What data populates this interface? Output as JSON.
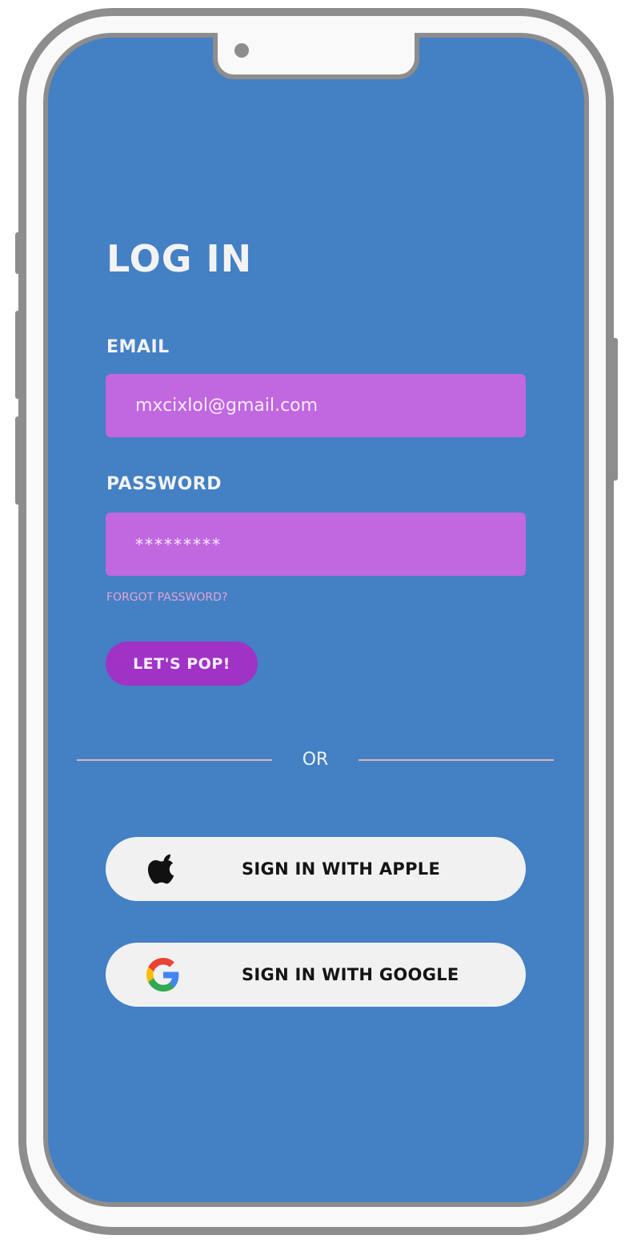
{
  "login": {
    "title": "LOG IN",
    "email_label": "EMAIL",
    "email_value": "mxcixlol@gmail.com",
    "password_label": "PASSWORD",
    "password_value": "*********",
    "forgot_password": "FORGOT PASSWORD?",
    "submit_label": "LET'S POP!"
  },
  "divider": {
    "text": "OR"
  },
  "social": {
    "apple_label": "SIGN IN WITH APPLE",
    "apple_icon": "apple-logo-icon",
    "google_label": "SIGN IN WITH GOOGLE",
    "google_icon": "google-logo-icon"
  },
  "colors": {
    "screen_background": "#4380c4",
    "input_background": "#c167e0",
    "primary_button": "#a033c6",
    "forgot_link": "#e7a3d6",
    "social_button": "#f1f1f1"
  }
}
